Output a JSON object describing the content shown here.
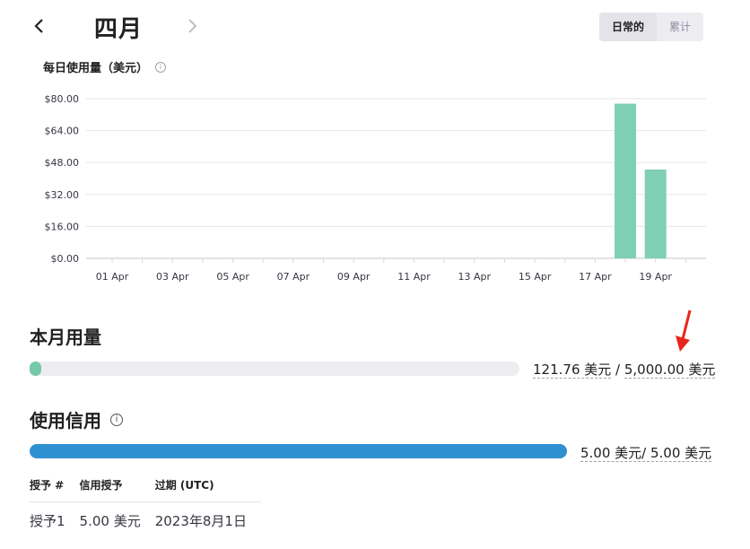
{
  "header": {
    "prev_icon": "chevron-left-icon",
    "next_icon": "chevron-right-icon",
    "month_title": "四月",
    "view_toggle": [
      "日常的",
      "累计"
    ],
    "active_view": "日常的"
  },
  "daily_chart": {
    "title": "每日使用量（美元）",
    "info_icon": "info-icon"
  },
  "chart_data": {
    "type": "bar",
    "ytick_labels": [
      "$0.00",
      "$16.00",
      "$32.00",
      "$48.00",
      "$64.00",
      "$80.00"
    ],
    "ylim": [
      0,
      80
    ],
    "yticks": [
      0,
      16,
      32,
      48,
      64,
      80
    ],
    "xtick_labels": [
      "01 Apr",
      "03 Apr",
      "05 Apr",
      "07 Apr",
      "09 Apr",
      "11 Apr",
      "13 Apr",
      "15 Apr",
      "17 Apr",
      "19 Apr"
    ],
    "categories": [
      "01 Apr",
      "02 Apr",
      "03 Apr",
      "04 Apr",
      "05 Apr",
      "06 Apr",
      "07 Apr",
      "08 Apr",
      "09 Apr",
      "10 Apr",
      "11 Apr",
      "12 Apr",
      "13 Apr",
      "14 Apr",
      "15 Apr",
      "16 Apr",
      "17 Apr",
      "18 Apr",
      "19 Apr",
      "20 Apr"
    ],
    "values": [
      0,
      0,
      0,
      0,
      0,
      0,
      0,
      0,
      0,
      0,
      0,
      0,
      0,
      0,
      0,
      0,
      0,
      77.5,
      44.5,
      0
    ],
    "grid": true,
    "bar_color": "#7fcfb5"
  },
  "monthly_usage": {
    "title": "本月用量",
    "used": "121.76 美元",
    "separator": " / ",
    "limit": "5,000.00 美元",
    "fraction": 0.024,
    "color": "#74c9ab"
  },
  "credit": {
    "title": "使用信用",
    "info_icon": "info-icon",
    "summary": "5.00 美元/ 5.00 美元",
    "fraction": 1.0,
    "color": "#2f8fd0"
  },
  "grants_table": {
    "headers": [
      "授予 #",
      "信用授予",
      "过期 (UTC)"
    ],
    "rows": [
      [
        "授予1",
        "5.00 美元",
        "2023年8月1日"
      ]
    ]
  },
  "annotation": {
    "arrow_color": "#e8261c"
  }
}
